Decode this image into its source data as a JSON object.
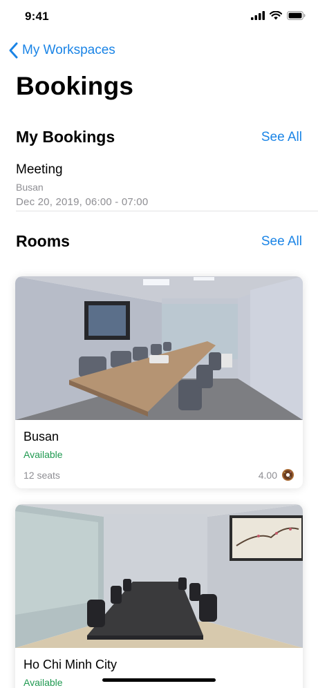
{
  "status_bar": {
    "time": "9:41"
  },
  "nav": {
    "back_label": "My Workspaces"
  },
  "page_title": "Bookings",
  "my_bookings": {
    "title": "My Bookings",
    "see_all": "See All",
    "items": [
      {
        "title": "Meeting",
        "location": "Busan",
        "time": "Dec 20, 2019, 06:00 - 07:00"
      }
    ]
  },
  "rooms": {
    "title": "Rooms",
    "see_all": "See All",
    "items": [
      {
        "name": "Busan",
        "status": "Available",
        "seats": "12 seats",
        "rating": "4.00"
      },
      {
        "name": "Ho Chi Minh City",
        "status": "Available"
      }
    ]
  },
  "colors": {
    "accent": "#1a84e6",
    "available": "#1f9950",
    "secondary_text": "#8e8e93"
  }
}
